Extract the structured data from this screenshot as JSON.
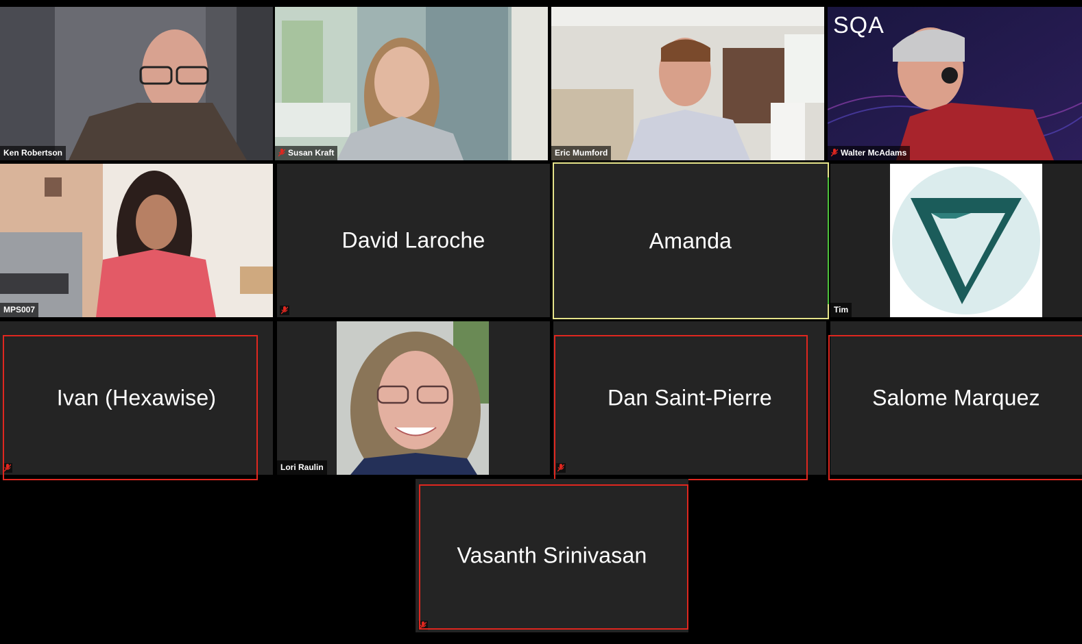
{
  "participants": [
    {
      "name": "Ken Robertson",
      "video": true,
      "muted": false
    },
    {
      "name": "Susan Kraft",
      "video": true,
      "muted": true
    },
    {
      "name": "Eric Mumford",
      "video": true,
      "muted": false
    },
    {
      "name": "Walter McAdams",
      "video": true,
      "muted": true
    },
    {
      "name": "MPS007",
      "video": true,
      "muted": false
    },
    {
      "name": "David Laroche",
      "video": false,
      "muted": true
    },
    {
      "name": "Amanda",
      "video": false,
      "muted": false,
      "active_speaker": true
    },
    {
      "name": "Tim",
      "video": true,
      "muted": false
    },
    {
      "name": "Ivan (Hexawise)",
      "video": false,
      "muted": true
    },
    {
      "name": "Lori Raulin",
      "video": true,
      "muted": false
    },
    {
      "name": "Dan Saint-Pierre",
      "video": false,
      "muted": true
    },
    {
      "name": "Salome Marquez",
      "video": false,
      "muted": false
    },
    {
      "name": "Vasanth Srinivasan",
      "video": false,
      "muted": true
    }
  ],
  "overlays": {
    "sqa_logo_text": "SQA"
  },
  "colors": {
    "tile_bg": "#242424",
    "muted_icon": "#e0271f",
    "highlight_frame": "#e0271f",
    "active_speaker_border": "#e6e48a",
    "tim_logo": "#1b5c5a"
  },
  "icons": [
    "mic-muted-icon",
    "sqa-logo",
    "v-triangle-logo"
  ]
}
